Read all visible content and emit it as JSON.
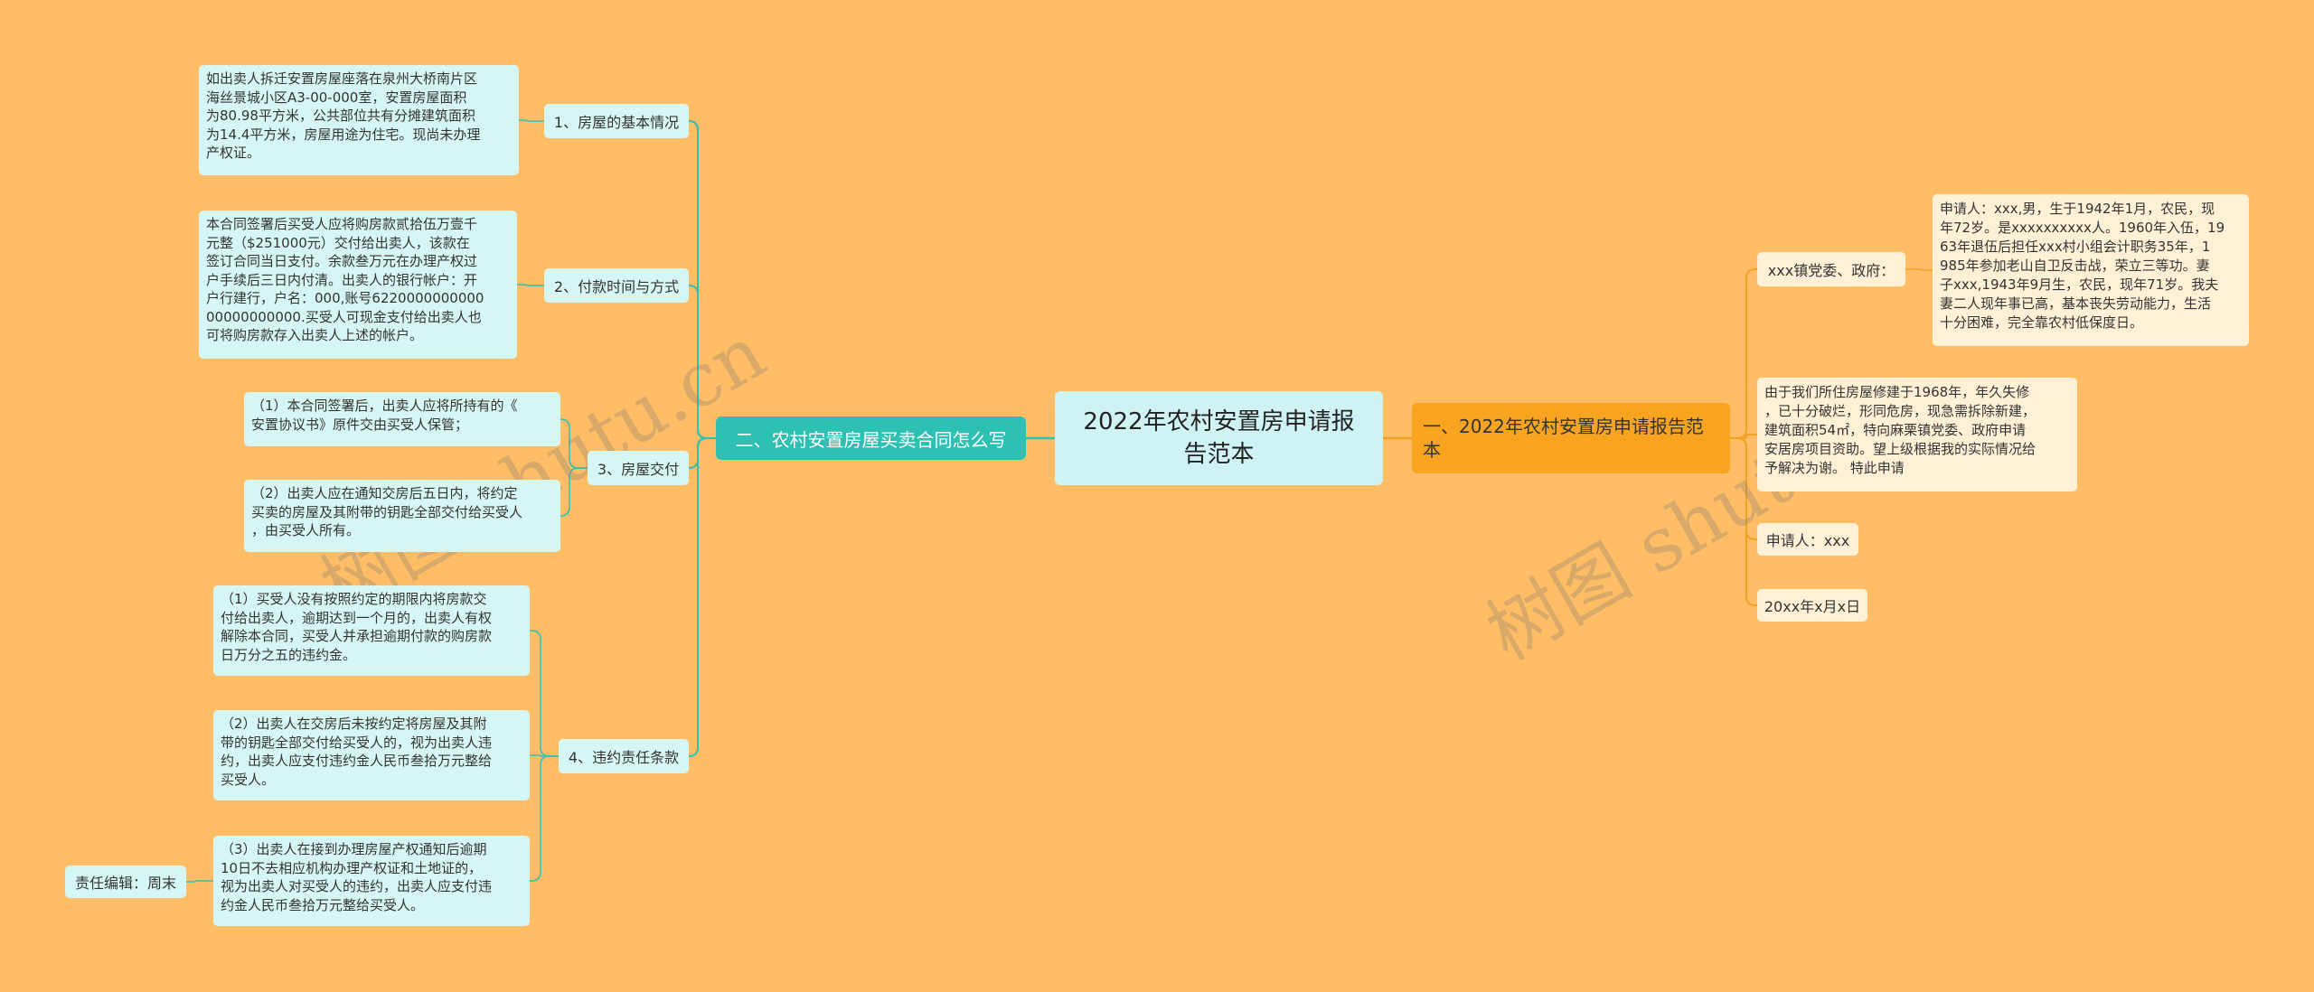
{
  "root": {
    "text": "2022年农村安置房申请报\n告范本"
  },
  "left_main": {
    "text": "二、农村安置房屋买卖合同怎么写",
    "children": [
      {
        "label": "1、房屋的基本情况",
        "leaves": [
          "如出卖人拆迁安置房屋座落在泉州大桥南片区\n海丝景城小区A3-00-000室，安置房屋面积\n为80.98平方米，公共部位共有分摊建筑面积\n为14.4平方米，房屋用途为住宅。现尚未办理\n产权证。"
        ]
      },
      {
        "label": "2、付款时间与方式",
        "leaves": [
          "本合同签署后买受人应将购房款贰拾伍万壹千\n元整（$251000元）交付给出卖人，该款在\n签订合同当日支付。余款叁万元在办理产权过\n户手续后三日内付清。出卖人的银行帐户：开\n户行建行，户名：000,账号6220000000000\n00000000000.买受人可现金支付给出卖人也\n可将购房款存入出卖人上述的帐户。"
        ]
      },
      {
        "label": "3、房屋交付",
        "leaves": [
          "（1）本合同签署后，出卖人应将所持有的《\n安置协议书》原件交由买受人保管；",
          "（2）出卖人应在通知交房后五日内，将约定\n买卖的房屋及其附带的钥匙全部交付给买受人\n，由买受人所有。"
        ]
      },
      {
        "label": "4、违约责任条款",
        "leaves": [
          "（1）买受人没有按照约定的期限内将房款交\n付给出卖人，逾期达到一个月的，出卖人有权\n解除本合同，买受人并承担逾期付款的购房款\n日万分之五的违约金。",
          "（2）出卖人在交房后未按约定将房屋及其附\n带的钥匙全部交付给买受人的，视为出卖人违\n约，出卖人应支付违约金人民币叁拾万元整给\n买受人。",
          "（3）出卖人在接到办理房屋产权通知后逾期\n10日不去相应机构办理产权证和土地证的，\n视为出卖人对买受人的违约，出卖人应支付违\n约金人民币叁拾万元整给买受人。"
        ]
      }
    ],
    "editor": "责任编辑：周末"
  },
  "right_main": {
    "text": "一、2022年农村安置房申请报告范\n本",
    "children": [
      {
        "label": "xxx镇党委、政府：",
        "leaves": [
          "申请人：xxx,男，生于1942年1月，农民，现\n年72岁。是xxxxxxxxxx人。1960年入伍，19\n63年退伍后担任xxx村小组会计职务35年，1\n985年参加老山自卫反击战，荣立三等功。妻\n子xxx,1943年9月生，农民，现年71岁。我夫\n妻二人现年事已高，基本丧失劳动能力，生活\n十分困难，完全靠农村低保度日。"
        ]
      },
      {
        "label": "由于我们所住房屋修建于1968年，年久失修\n，已十分破烂，形同危房，现急需拆除新建，\n建筑面积54㎡，特向麻栗镇党委、政府申请\n安居房项目资助。望上级根据我的实际情况给\n予解决为谢。 特此申请",
        "leaves": []
      },
      {
        "label": "申请人：xxx",
        "leaves": []
      },
      {
        "label": "20xx年x月x日",
        "leaves": []
      }
    ]
  },
  "watermarks": [
    "树图 shutu.cn",
    "树图 shutu.cn"
  ],
  "colors": {
    "background": "#FFBD66",
    "root_fill": "#CFF3F2",
    "left_main_fill": "#2EC1B3",
    "left_node_fill": "#D6F6F3",
    "left_line": "#2EC1B3",
    "right_main_fill": "#F8A420",
    "right_node_fill": "#FFF0D6",
    "right_line": "#F3A126"
  }
}
